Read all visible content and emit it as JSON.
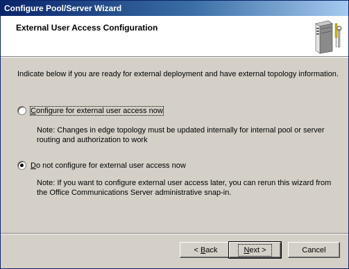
{
  "window": {
    "title": "Configure Pool/Server Wizard"
  },
  "header": {
    "title": "External User Access Configuration",
    "icon": "server-tools-icon"
  },
  "content": {
    "intro": "Indicate below if you are ready for external deployment and have external topology information.",
    "options": [
      {
        "label_accel": "C",
        "label_rest": "onfigure for external user access now",
        "checked": false,
        "note_line1": "Note: Changes in edge topology must be updated internally for internal pool or server",
        "note_line2": "routing and authorization to work"
      },
      {
        "label_accel": "D",
        "label_rest": "o not configure for external user access now",
        "checked": true,
        "note_line1": "Note: If you want to configure external user access later, you can rerun this wizard from",
        "note_line2": "the Office Communications Server administrative snap-in."
      }
    ]
  },
  "buttons": {
    "back_prefix": "< ",
    "back_accel": "B",
    "back_rest": "ack",
    "next_accel": "N",
    "next_rest": "ext >",
    "cancel": "Cancel"
  }
}
